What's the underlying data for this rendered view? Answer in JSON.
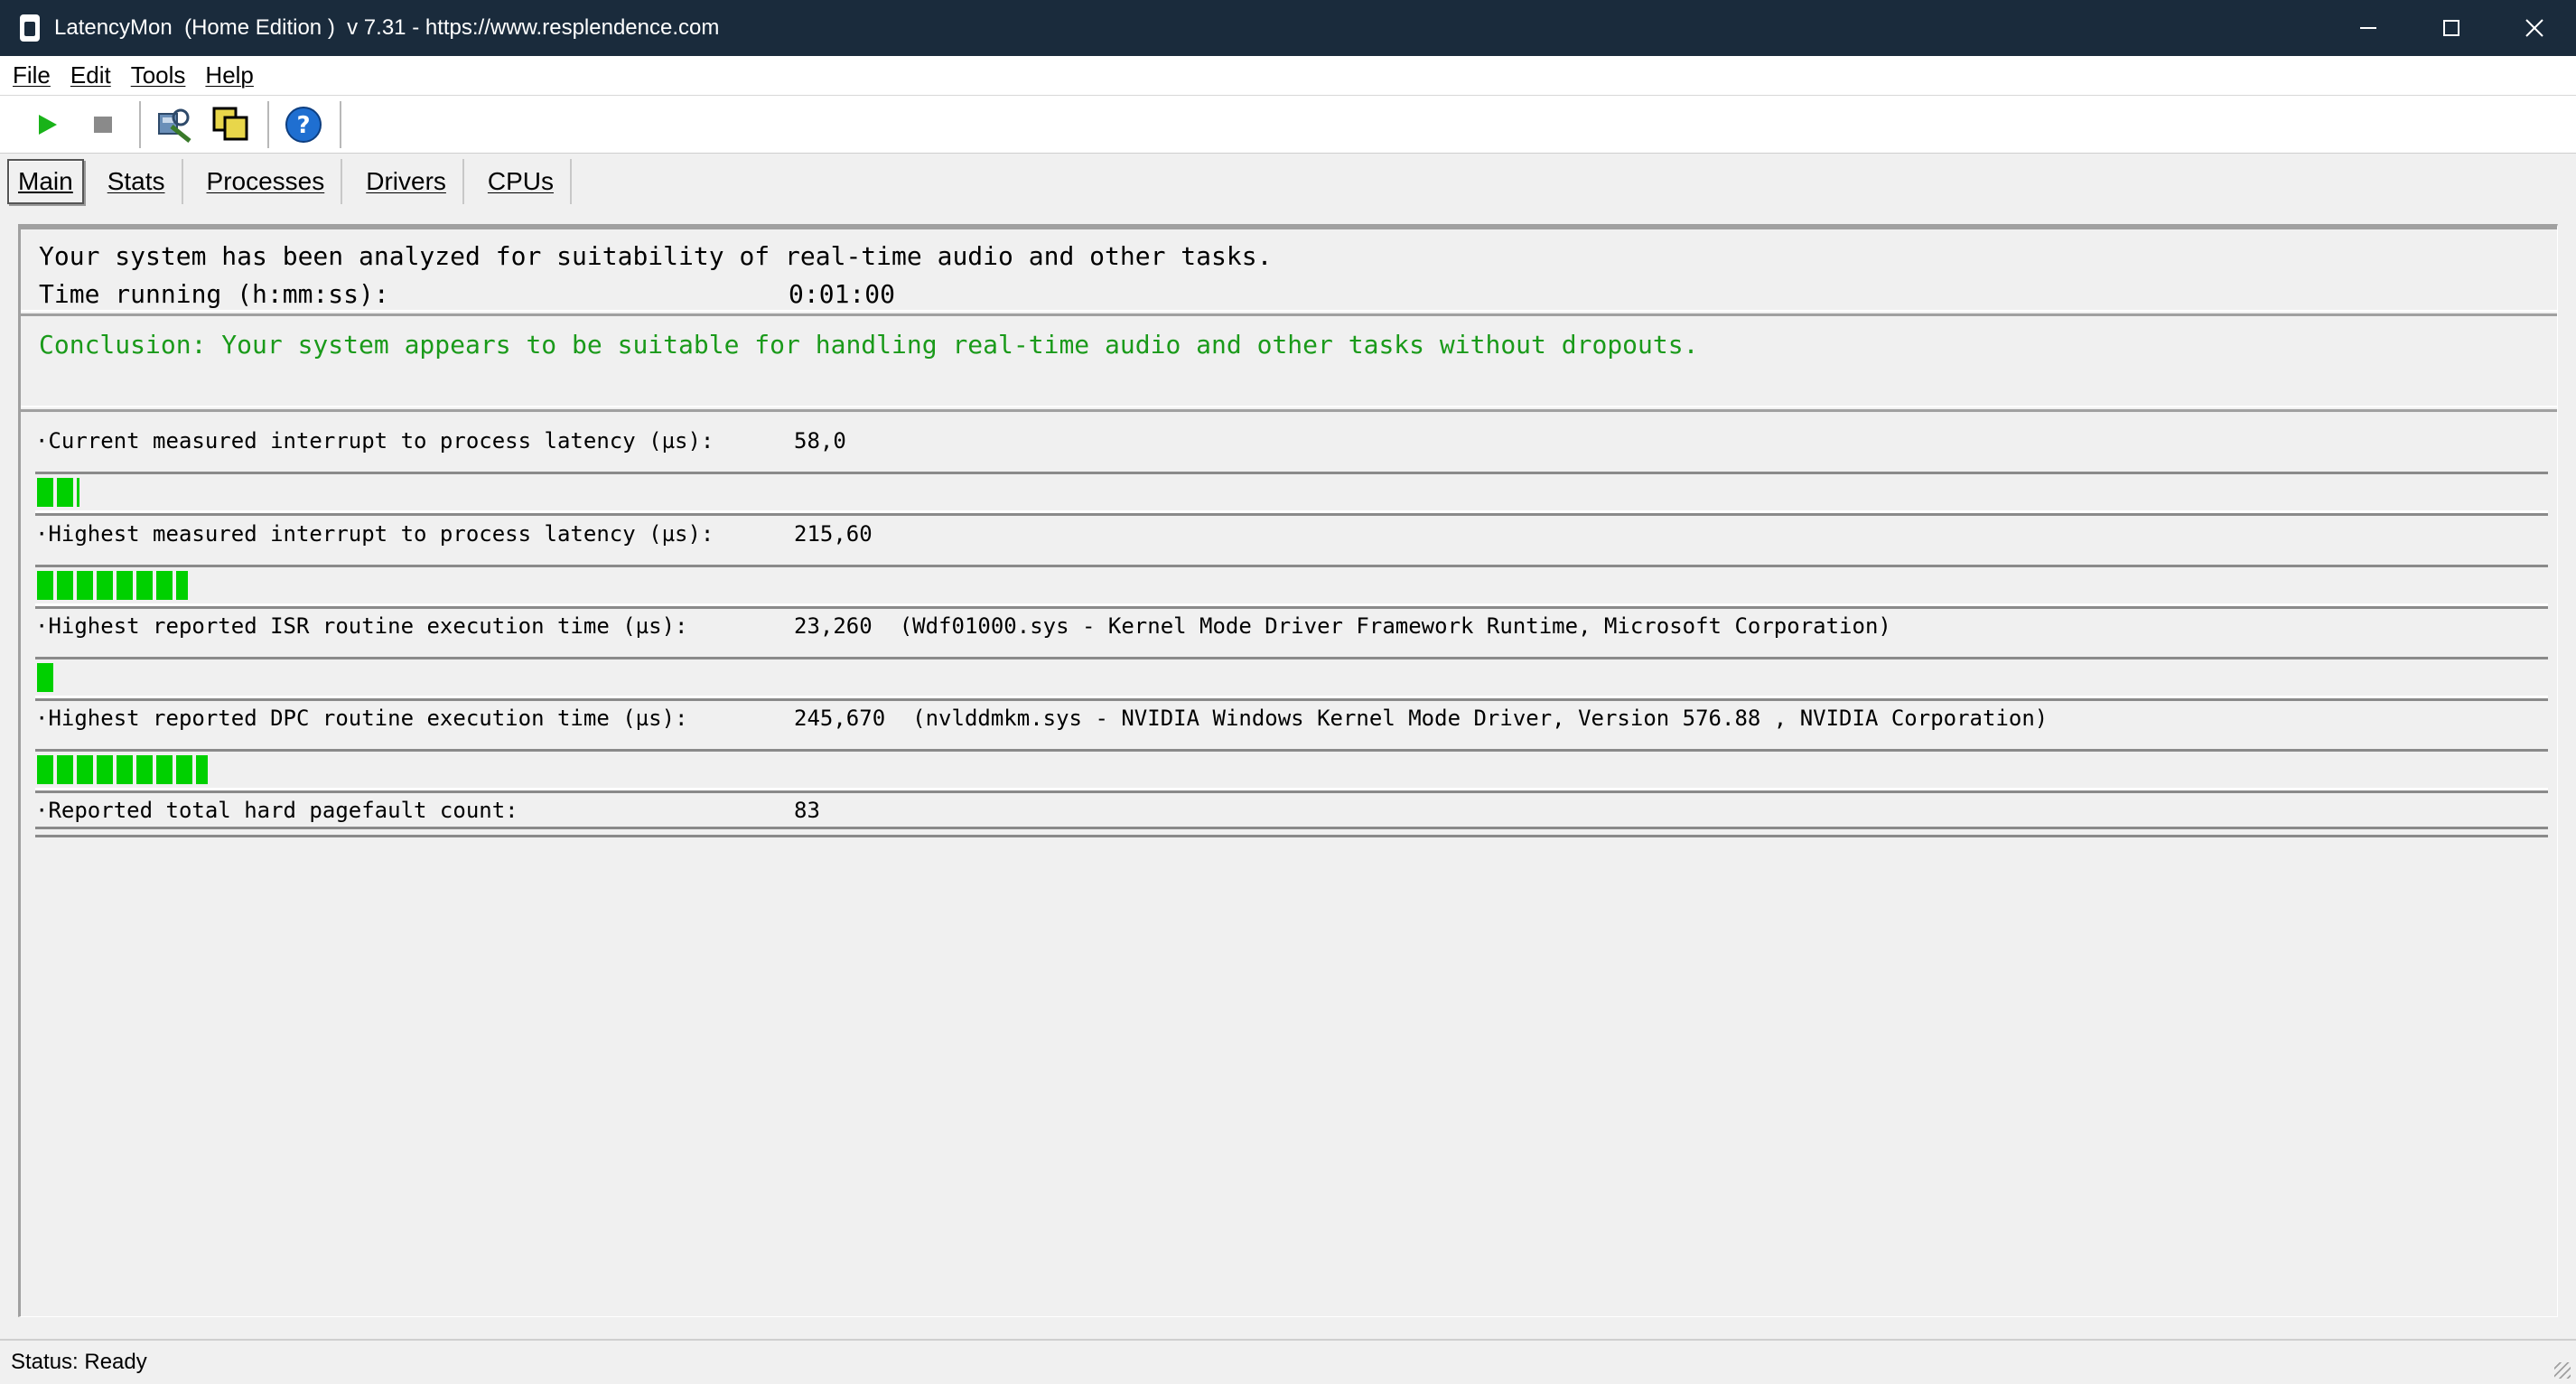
{
  "window": {
    "title": "LatencyMon  (Home Edition )  v 7.31 - https://www.resplendence.com"
  },
  "menu": {
    "items": [
      "File",
      "Edit",
      "Tools",
      "Help"
    ]
  },
  "toolbar": {
    "buttons": [
      {
        "icon": "play-icon",
        "color": "#19b319"
      },
      {
        "icon": "stop-icon",
        "color": "#8a8a8a"
      },
      {
        "icon": "driver-search-icon"
      },
      {
        "icon": "windows-overlap-icon"
      },
      {
        "icon": "help-icon",
        "color": "#1f6fd1"
      }
    ]
  },
  "tabs": {
    "items": [
      "Main",
      "Stats",
      "Processes",
      "Drivers",
      "CPUs"
    ],
    "active": "Main"
  },
  "summary": {
    "line1": "Your system has been analyzed for suitability of real-time audio and other tasks.",
    "time_label": "Time running (h:mm:ss):",
    "time_value": "0:01:00"
  },
  "conclusion": {
    "text": "Conclusion: Your system appears to be suitable for handling real-time audio and other tasks without dropouts.",
    "color": "#1a9a1a"
  },
  "metrics": [
    {
      "label": "·Current measured interrupt to process latency (µs):",
      "value": "58,0",
      "detail": "",
      "bar_fraction": 0.017
    },
    {
      "label": "·Highest measured interrupt to process latency (µs):",
      "value": "215,60",
      "detail": "",
      "bar_fraction": 0.06
    },
    {
      "label": "·Highest reported ISR routine execution time (µs):",
      "value": "23,260",
      "detail": "(Wdf01000.sys - Kernel Mode Driver Framework Runtime, Microsoft Corporation)",
      "bar_fraction": 0.008
    },
    {
      "label": "·Highest reported DPC routine execution time (µs):",
      "value": "245,670",
      "detail": "(nvlddmkm.sys - NVIDIA Windows Kernel Mode Driver, Version 576.88 , NVIDIA Corporation)",
      "bar_fraction": 0.068
    }
  ],
  "pagefault": {
    "label": "·Reported total hard pagefault count:",
    "value": "83"
  },
  "status": {
    "text": "Status: Ready"
  },
  "colors": {
    "bar_green": "#00d000",
    "titlebar": "#1a2b3c"
  }
}
